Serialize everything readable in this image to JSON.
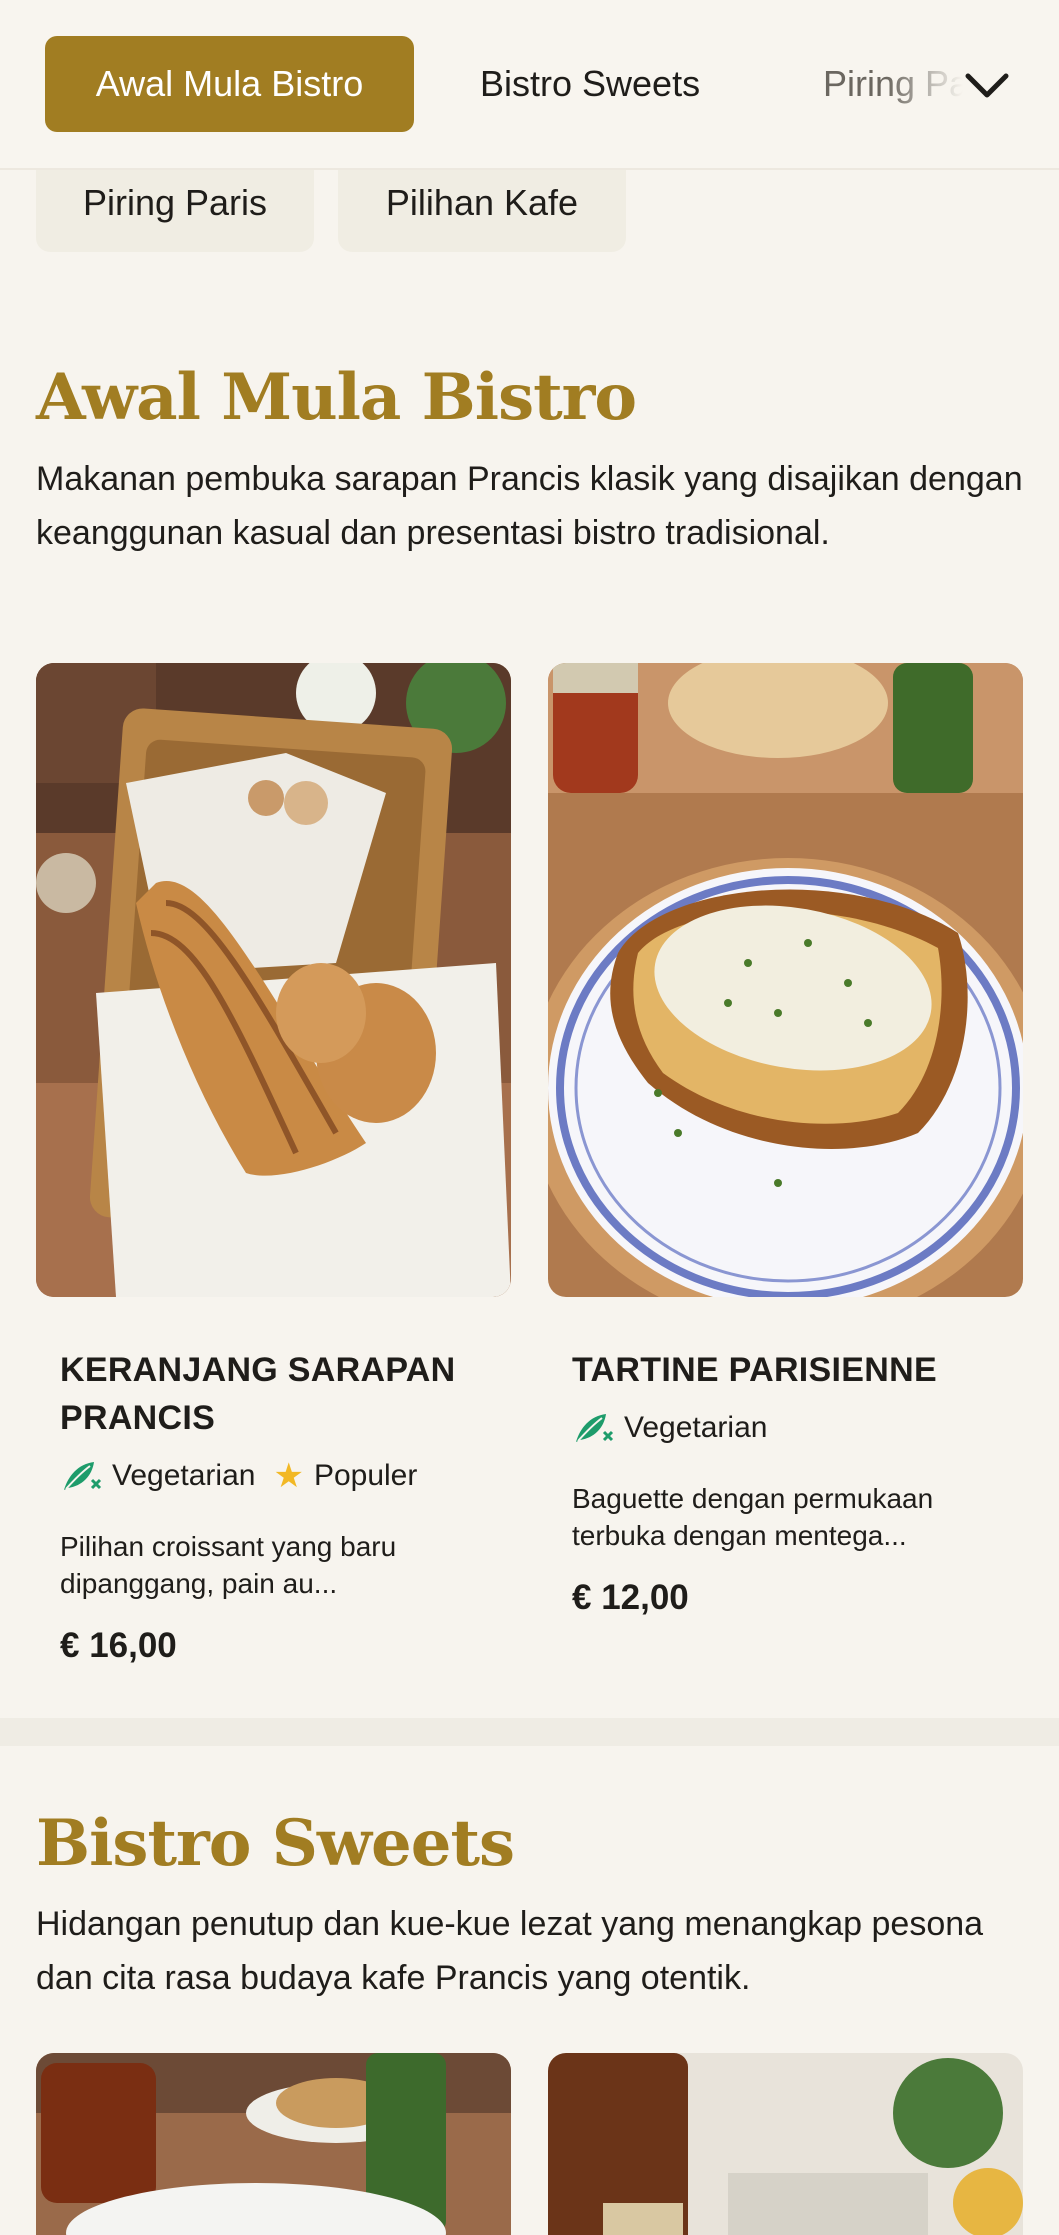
{
  "nav": {
    "tabs": [
      {
        "label": "Awal Mula Bistro",
        "active": true
      },
      {
        "label": "Bistro Sweets",
        "active": false
      },
      {
        "label": "Piring Paris",
        "active": false
      }
    ],
    "expand_icon": "chevron-down-icon",
    "pills": [
      {
        "label": "Piring Paris"
      },
      {
        "label": "Pilihan Kafe"
      }
    ]
  },
  "sections": [
    {
      "title": "Awal Mula Bistro",
      "description": "Makanan pembuka sarapan Prancis klasik yang disajikan dengan keanggunan kasual dan presentasi bistro tradisional.",
      "items": [
        {
          "name": "KERANJANG SARAPAN PRANCIS",
          "tags": [
            {
              "label": "Vegetarian",
              "icon": "vegetarian-leaf-icon"
            },
            {
              "label": "Populer",
              "icon": "star-icon"
            }
          ],
          "description": "Pilihan croissant yang baru dipanggang, pain au...",
          "price": "€ 16,00"
        },
        {
          "name": "TARTINE PARISIENNE",
          "tags": [
            {
              "label": "Vegetarian",
              "icon": "vegetarian-leaf-icon"
            }
          ],
          "description": "Baguette dengan permukaan terbuka dengan mentega...",
          "price": "€ 12,00"
        }
      ]
    },
    {
      "title": "Bistro Sweets",
      "description": "Hidangan penutup dan kue-kue lezat yang menangkap pesona dan cita rasa budaya kafe Prancis yang otentik."
    }
  ],
  "colors": {
    "accent": "#a17d22",
    "background": "#f7f4ee",
    "vegetarian": "#1e9c6b",
    "star": "#f2b824"
  }
}
